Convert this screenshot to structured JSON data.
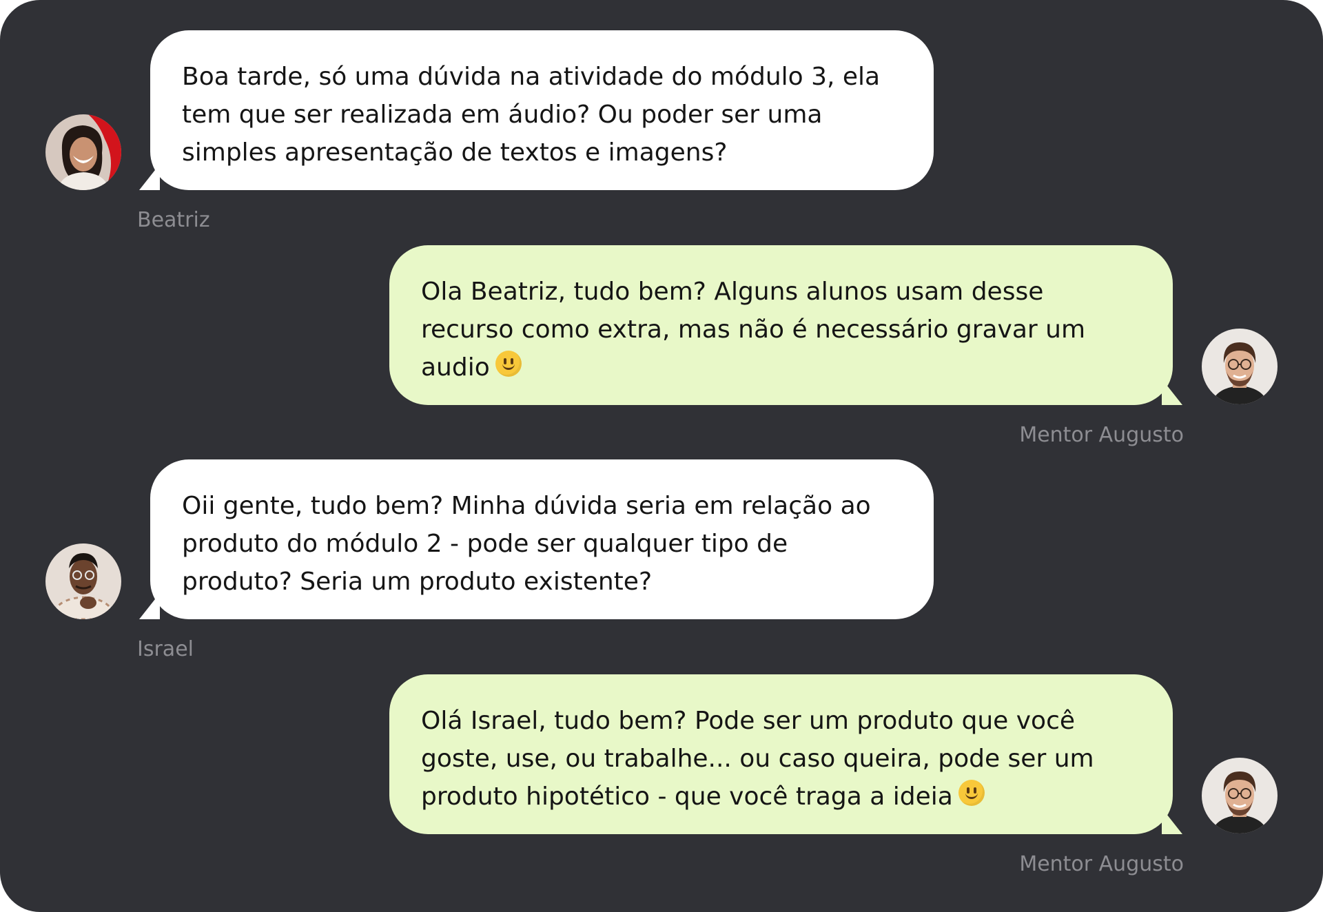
{
  "colors": {
    "background": "#303136",
    "incoming_bubble": "#ffffff",
    "outgoing_bubble": "#e8f8c8",
    "author_text": "#8d8d92"
  },
  "messages": [
    {
      "author": "Beatriz",
      "direction": "incoming",
      "avatar_icon": "woman-portrait-avatar",
      "text": "Boa tarde, só uma dúvida na atividade do módulo 3, ela\ntem que ser realizada em áudio? Ou poder ser uma\nsimples apresentação de textos e imagens?"
    },
    {
      "author": "Mentor Augusto",
      "direction": "outgoing",
      "avatar_icon": "man-glasses-portrait-avatar",
      "text": "Ola Beatriz, tudo bem? Alguns alunos usam desse\nrecurso como extra, mas não é necessário gravar um\naudio",
      "emoji": "slightly-smiling-face-icon"
    },
    {
      "author": "Israel",
      "direction": "incoming",
      "avatar_icon": "man-portrait-avatar",
      "text": "Oii gente, tudo bem? Minha dúvida seria em relação ao\nproduto do módulo 2 - pode ser qualquer tipo de\nproduto? Seria um produto existente?"
    },
    {
      "author": "Mentor Augusto",
      "direction": "outgoing",
      "avatar_icon": "man-glasses-portrait-avatar",
      "text": "Olá Israel, tudo bem? Pode ser um produto que você\ngoste, use, ou trabalhe... ou caso queira, pode ser um\nproduto hipotético - que você traga a ideia",
      "emoji": "slightly-smiling-face-icon"
    }
  ]
}
